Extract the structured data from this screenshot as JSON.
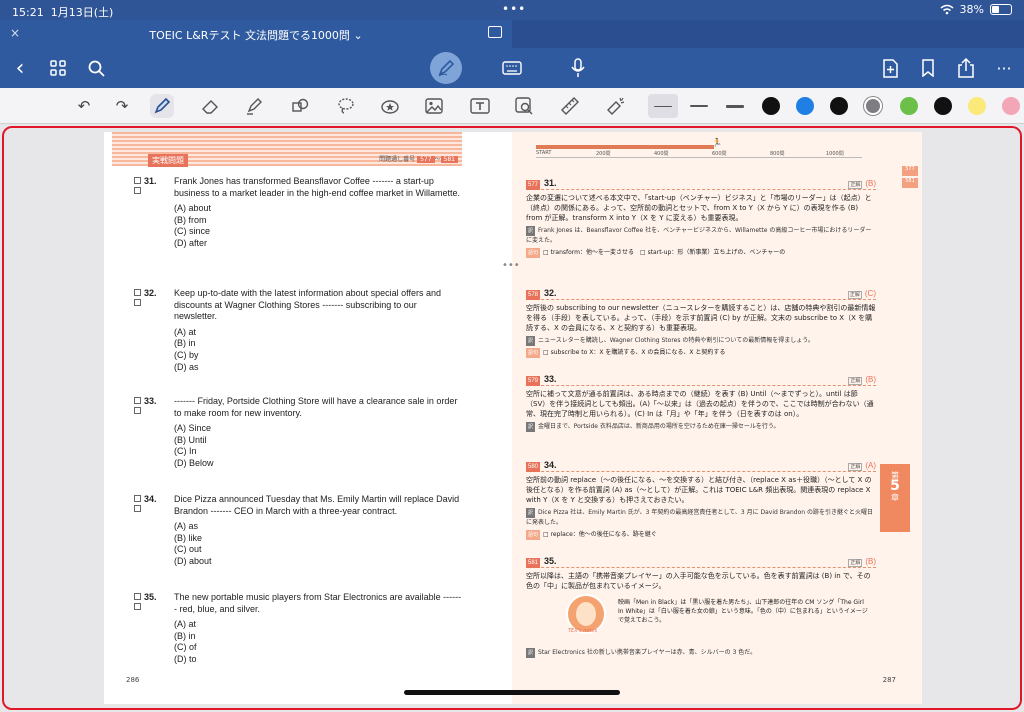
{
  "status": {
    "time": "15:21",
    "date": "1月13日(土)",
    "battery": "38%"
  },
  "tab": {
    "close": "×",
    "title": "TOEIC L&Rテスト 文法問題でる1000問",
    "chevron": "⌄"
  },
  "nav": {
    "back": "‹",
    "grid": "⊞",
    "search": "⌕",
    "more": "···"
  },
  "left_page": {
    "section_label": "実戦問題",
    "answer_no_label": "問題通し番号",
    "questions": [
      {
        "num": "31.",
        "text": "Frank Jones has transformed Beansflavor Coffee ------- a start-up business to a market leader in the high-end coffee market in Willamette.",
        "options": [
          "(A) about",
          "(B) from",
          "(C) since",
          "(D) after"
        ]
      },
      {
        "num": "32.",
        "text": "Keep up-to-date with the latest information about special offers and discounts at Wagner Clothing Stores ------- subscribing to our newsletter.",
        "options": [
          "(A) at",
          "(B) in",
          "(C) by",
          "(D) as"
        ]
      },
      {
        "num": "33.",
        "text": "------- Friday, Portside Clothing Store will have a clearance sale in order to make room for new inventory.",
        "options": [
          "(A) Since",
          "(B) Until",
          "(C) In",
          "(D) Below"
        ]
      },
      {
        "num": "34.",
        "text": "Dice Pizza announced Tuesday that Ms. Emily Martin will replace David Brandon ------- CEO in March with a three-year contract.",
        "options": [
          "(A) as",
          "(B) like",
          "(C) out",
          "(D) about"
        ]
      },
      {
        "num": "35.",
        "text": "The new portable music players from Star Electronics are available ------- red, blue, and silver.",
        "options": [
          "(A) at",
          "(B) in",
          "(C) of",
          "(D) to"
        ]
      }
    ],
    "page_number": "286"
  },
  "right_page": {
    "progress": {
      "label_start": "START",
      "ticks": [
        "200問",
        "400問",
        "600問",
        "800問",
        "1000問"
      ]
    },
    "answers": [
      {
        "badge": "577",
        "num": "31.",
        "key": "(B)",
        "body": "企業の変遷について述べる本文中で、「start-up（ベンチャー）ビジネス」と「市場のリーダー」は（起点）と（終点）の関係にある。よって、空所前の動詞とセットで、from X to Y（X から Y に）の表現を作る (B) from が正解。transform X into Y（X を Y に変える）も重要表現。",
        "translation": "Frank Jones は、Beansflavor Coffee 社を、ベンチャービジネスから、Willamette の高級コーヒー市場におけるリーダーに変えた。",
        "vocab": "□ transform：他～を一変させる　□ start-up：形（新事業）立ち上げの、ベンチャーの"
      },
      {
        "badge": "578",
        "num": "32.",
        "key": "(C)",
        "body": "空所後の subscribing to our newsletter（ニュースレターを購読すること）は、店舗の特典や割引の最新情報を得る（手段）を表している。よって、（手段）を示す前置詞 (C) by が正解。文末の subscribe to X（X を購読する、X の会員になる、X と契約する）も重要表現。",
        "translation": "ニュースレターを購読し、Wagner Clothing Stores の特典や割引についての最新情報を得ましょう。",
        "vocab": "□ subscribe to X：X を購読する、X の会員になる、X と契約する"
      },
      {
        "badge": "579",
        "num": "33.",
        "key": "(B)",
        "body": "空所に補って文意が通る前置詞は、ある時点までの（継続）を表す (B) Until（～までずっと）。until は節（SV）を伴う接続詞としても頻出。(A)「～以来」は（過去の起点）を伴うので、ここでは時制が合わない（通常、現在完了時制と用いられる）。(C) In は「月」や「年」を伴う（日を表すのは on）。",
        "translation": "金曜日まで、Portside 衣料品店は、新商品用の場所を空けるため在庫一掃セールを行う。",
        "vocab": ""
      },
      {
        "badge": "580",
        "num": "34.",
        "key": "(A)",
        "body": "空所前の動詞 replace（～の後任になる、～を交換する）と結び付き、（replace X as＋役職）（～として X の後任となる）を作る前置詞 (A) as（～として）が正解。これは TOEIC L&R 頻出表現。関連表現の replace X with Y（X を Y と交換する）も押さえておきたい。",
        "translation": "Dice Pizza 社は、Emily Martin 氏が、3 年契約の最高経営責任者として、3 月に David Brandon の跡を引き継ぐと火曜日に発表した。",
        "vocab": "□ replace：他～の後任になる、跡を継ぐ"
      },
      {
        "badge": "581",
        "num": "35.",
        "key": "(B)",
        "body": "空所以降は、主語の「携帯音楽プレイヤー」の入手可能な色を示している。色を表す前置詞は (B) in で、その色の「中」に製品が包まれているイメージ。",
        "translation": "Star Electronics 社の新しい携帯音楽プレイヤーは赤、青、シルバーの 3 色だ。",
        "vocab": ""
      }
    ],
    "note": "映画「Men in Black」は「黒い服を着た男たち」、山下達郎の往年の CM ソング「The Girl In White」は「白い服を着た女の娘」という意味。「色の（中）に包まれる」というイメージで覚えておこう。",
    "avatar_label": "TEX's notes",
    "side_tabs": [
      "577",
      "581"
    ],
    "chapter": {
      "prefix": "第",
      "num": "5",
      "suffix": "章"
    },
    "page_number": "287"
  }
}
